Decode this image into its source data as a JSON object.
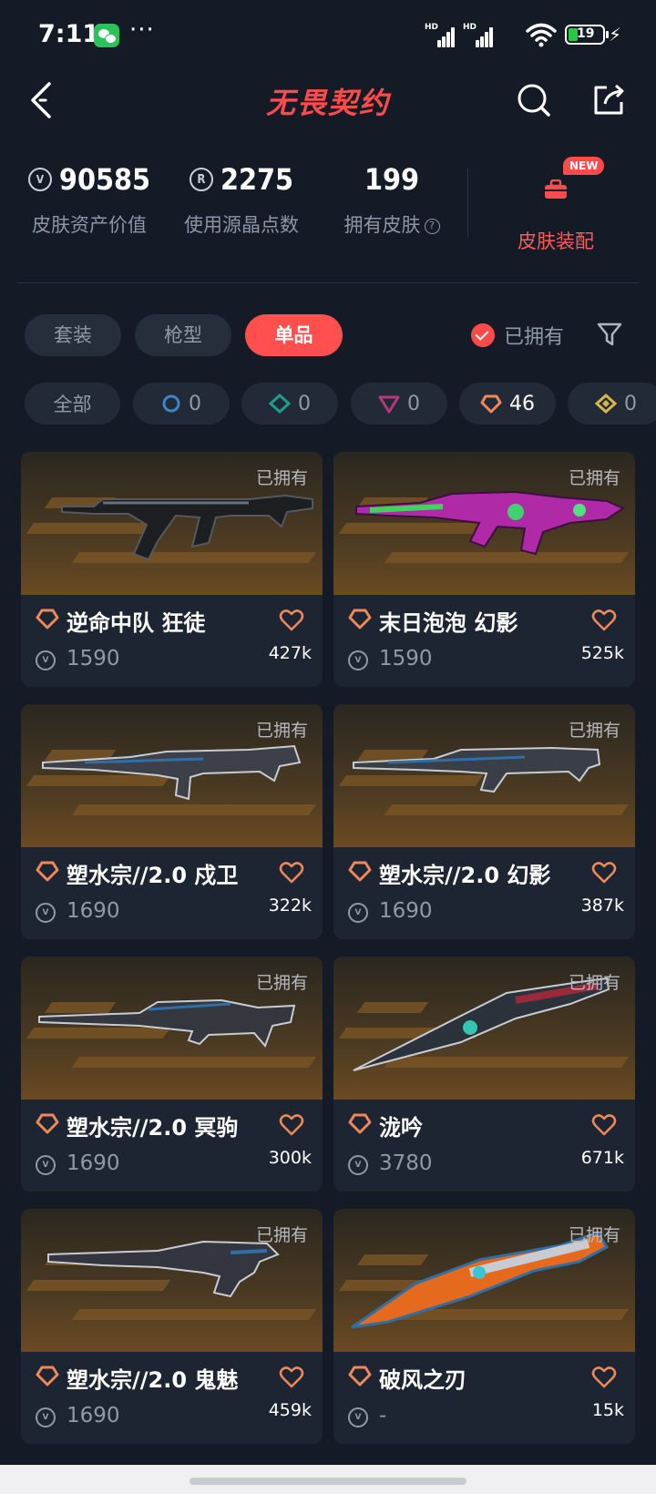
{
  "status_bar": {
    "time": "7:11",
    "dots": "···",
    "battery": "19",
    "network": "HD"
  },
  "header": {
    "title": "无畏契约"
  },
  "stats": [
    {
      "value": "90585",
      "label": "皮肤资产价值",
      "icon": "valorant-points-icon"
    },
    {
      "value": "2275",
      "label": "使用源晶点数",
      "icon": "radianite-icon",
      "icon_letter": "R"
    },
    {
      "value": "199",
      "label": "拥有皮肤",
      "icon": "help-icon"
    }
  ],
  "equip": {
    "label": "皮肤装配",
    "badge": "NEW"
  },
  "tabs": [
    {
      "label": "套装",
      "active": false
    },
    {
      "label": "枪型",
      "active": false
    },
    {
      "label": "单品",
      "active": true
    }
  ],
  "owned_filter": {
    "label": "已拥有",
    "checked": true
  },
  "rarity_chips": [
    {
      "label": "全部"
    },
    {
      "count": "0",
      "icon": "select-tier-icon"
    },
    {
      "count": "0",
      "icon": "deluxe-tier-icon"
    },
    {
      "count": "0",
      "icon": "premium-tier-icon"
    },
    {
      "count": "46",
      "icon": "exclusive-tier-icon"
    },
    {
      "count": "0",
      "icon": "ultra-tier-icon"
    }
  ],
  "cards": [
    {
      "name": "逆命中队 狂徒",
      "price": "1590",
      "likes": "427k",
      "owned": "已拥有"
    },
    {
      "name": "末日泡泡 幻影",
      "price": "1590",
      "likes": "525k",
      "owned": "已拥有"
    },
    {
      "name": "塑水宗//2.0 戍卫",
      "price": "1690",
      "likes": "322k",
      "owned": "已拥有"
    },
    {
      "name": "塑水宗//2.0 幻影",
      "price": "1690",
      "likes": "387k",
      "owned": "已拥有"
    },
    {
      "name": "塑水宗//2.0 冥驹",
      "price": "1690",
      "likes": "300k",
      "owned": "已拥有"
    },
    {
      "name": "泷吟",
      "price": "3780",
      "likes": "671k",
      "owned": "已拥有"
    },
    {
      "name": "塑水宗//2.0 鬼魅",
      "price": "1690",
      "likes": "459k",
      "owned": "已拥有"
    },
    {
      "name": "破风之刃",
      "price": "-",
      "likes": "15k",
      "owned": "已拥有"
    }
  ],
  "colors": {
    "accent": "#ff4f4f",
    "tier": "#f0895a",
    "bg": "#141b26"
  }
}
